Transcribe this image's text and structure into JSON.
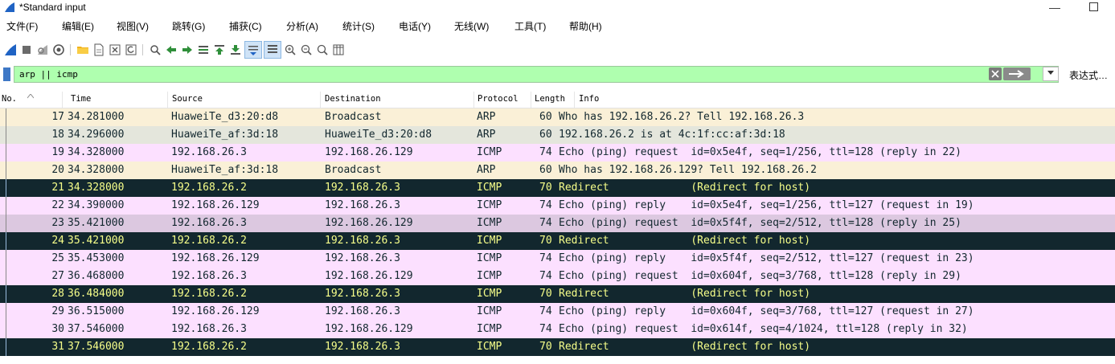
{
  "window": {
    "title": "*Standard input",
    "minimize_glyph": "—"
  },
  "menu": [
    "文件(F)",
    "编辑(E)",
    "视图(V)",
    "跳转(G)",
    "捕获(C)",
    "分析(A)",
    "统计(S)",
    "电话(Y)",
    "无线(W)",
    "工具(T)",
    "帮助(H)"
  ],
  "toolbar_icons": [
    "shark-fin-start-icon",
    "stop-icon",
    "restart-icon",
    "options-gear-icon",
    "open-folder-icon",
    "file-icon",
    "close-file-icon",
    "reload-icon",
    "find-icon",
    "back-arrow-icon",
    "forward-arrow-icon",
    "goto-packet-icon",
    "first-packet-icon",
    "last-packet-icon",
    "autoscroll-icon",
    "colorize-icon",
    "zoom-in-icon",
    "zoom-out-icon",
    "zoom-reset-icon",
    "resize-columns-icon"
  ],
  "filter": {
    "value": "arp || icmp",
    "expression_label": "表达式…"
  },
  "columns": {
    "no": "No.",
    "time": "Time",
    "source": "Source",
    "destination": "Destination",
    "protocol": "Protocol",
    "length": "Length",
    "info": "Info"
  },
  "colors": {
    "arp_bg": "#faf0d7",
    "icmp_bg": "#fce0ff",
    "redirect_bg": "#12272e",
    "redirect_fg": "#f7ff8a",
    "filter_bg": "#afffaf"
  },
  "packets": [
    {
      "no": "17",
      "time": "34.281000",
      "src": "HuaweiTe_d3:20:d8",
      "dst": "Broadcast",
      "proto": "ARP",
      "len": "60",
      "info": "Who has 192.168.26.2? Tell 192.168.26.3",
      "style": "arp"
    },
    {
      "no": "18",
      "time": "34.296000",
      "src": "HuaweiTe_af:3d:18",
      "dst": "HuaweiTe_d3:20:d8",
      "proto": "ARP",
      "len": "60",
      "info": "192.168.26.2 is at 4c:1f:cc:af:3d:18",
      "style": "arp-alt"
    },
    {
      "no": "19",
      "time": "34.328000",
      "src": "192.168.26.3",
      "dst": "192.168.26.129",
      "proto": "ICMP",
      "len": "74",
      "info": "Echo (ping) request  id=0x5e4f, seq=1/256, ttl=128 (reply in 22)",
      "style": "icmp"
    },
    {
      "no": "20",
      "time": "34.328000",
      "src": "HuaweiTe_af:3d:18",
      "dst": "Broadcast",
      "proto": "ARP",
      "len": "60",
      "info": "Who has 192.168.26.129? Tell 192.168.26.2",
      "style": "arp"
    },
    {
      "no": "21",
      "time": "34.328000",
      "src": "192.168.26.2",
      "dst": "192.168.26.3",
      "proto": "ICMP",
      "len": "70",
      "info": "Redirect             (Redirect for host)",
      "style": "redirect"
    },
    {
      "no": "22",
      "time": "34.390000",
      "src": "192.168.26.129",
      "dst": "192.168.26.3",
      "proto": "ICMP",
      "len": "74",
      "info": "Echo (ping) reply    id=0x5e4f, seq=1/256, ttl=127 (request in 19)",
      "style": "icmp"
    },
    {
      "no": "23",
      "time": "35.421000",
      "src": "192.168.26.3",
      "dst": "192.168.26.129",
      "proto": "ICMP",
      "len": "74",
      "info": "Echo (ping) request  id=0x5f4f, seq=2/512, ttl=128 (reply in 25)",
      "style": "icmp-sel"
    },
    {
      "no": "24",
      "time": "35.421000",
      "src": "192.168.26.2",
      "dst": "192.168.26.3",
      "proto": "ICMP",
      "len": "70",
      "info": "Redirect             (Redirect for host)",
      "style": "redirect"
    },
    {
      "no": "25",
      "time": "35.453000",
      "src": "192.168.26.129",
      "dst": "192.168.26.3",
      "proto": "ICMP",
      "len": "74",
      "info": "Echo (ping) reply    id=0x5f4f, seq=2/512, ttl=127 (request in 23)",
      "style": "icmp"
    },
    {
      "no": "27",
      "time": "36.468000",
      "src": "192.168.26.3",
      "dst": "192.168.26.129",
      "proto": "ICMP",
      "len": "74",
      "info": "Echo (ping) request  id=0x604f, seq=3/768, ttl=128 (reply in 29)",
      "style": "icmp"
    },
    {
      "no": "28",
      "time": "36.484000",
      "src": "192.168.26.2",
      "dst": "192.168.26.3",
      "proto": "ICMP",
      "len": "70",
      "info": "Redirect             (Redirect for host)",
      "style": "redirect"
    },
    {
      "no": "29",
      "time": "36.515000",
      "src": "192.168.26.129",
      "dst": "192.168.26.3",
      "proto": "ICMP",
      "len": "74",
      "info": "Echo (ping) reply    id=0x604f, seq=3/768, ttl=127 (request in 27)",
      "style": "icmp"
    },
    {
      "no": "30",
      "time": "37.546000",
      "src": "192.168.26.3",
      "dst": "192.168.26.129",
      "proto": "ICMP",
      "len": "74",
      "info": "Echo (ping) request  id=0x614f, seq=4/1024, ttl=128 (reply in 32)",
      "style": "icmp"
    },
    {
      "no": "31",
      "time": "37.546000",
      "src": "192.168.26.2",
      "dst": "192.168.26.3",
      "proto": "ICMP",
      "len": "70",
      "info": "Redirect             (Redirect for host)",
      "style": "redirect"
    }
  ]
}
